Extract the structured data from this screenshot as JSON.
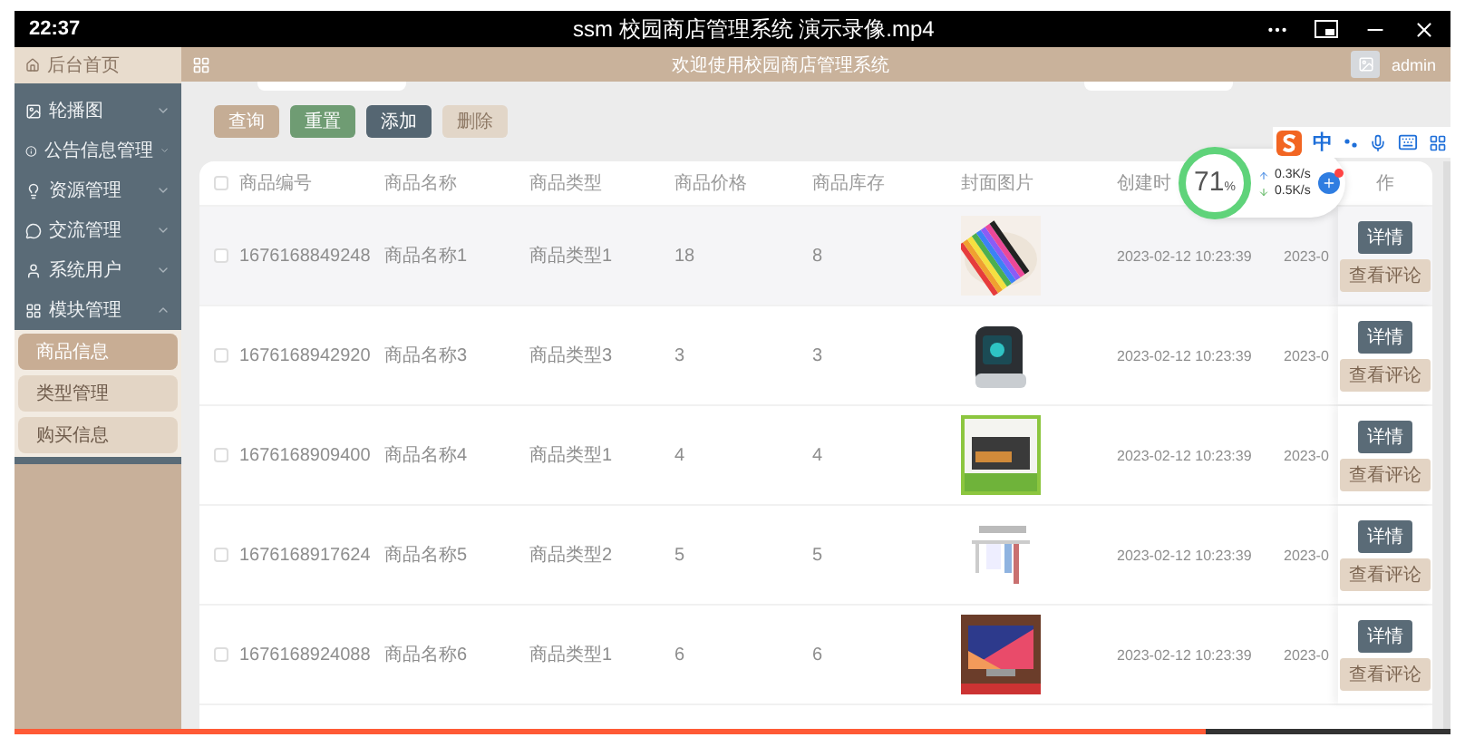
{
  "player": {
    "time": "22:37",
    "title": "ssm 校园商店管理系统 演示录像.mp4",
    "progress": {
      "level": 0.83
    }
  },
  "sidebar": {
    "home": "后台首页",
    "items": [
      {
        "label": "轮播图",
        "expanded": false
      },
      {
        "label": "公告信息管理",
        "expanded": false
      },
      {
        "label": "资源管理",
        "expanded": false
      },
      {
        "label": "交流管理",
        "expanded": false
      },
      {
        "label": "系统用户",
        "expanded": false
      },
      {
        "label": "模块管理",
        "expanded": true,
        "children": [
          {
            "label": "商品信息",
            "selected": true
          },
          {
            "label": "类型管理",
            "selected": false
          },
          {
            "label": "购买信息",
            "selected": false
          }
        ]
      }
    ]
  },
  "header": {
    "welcome": "欢迎使用校园商店管理系统",
    "user": "admin"
  },
  "toolbar": {
    "buttons": [
      {
        "label": "查询",
        "kind": "search"
      },
      {
        "label": "重置",
        "kind": "reset"
      },
      {
        "label": "添加",
        "kind": "add"
      },
      {
        "label": "删除",
        "kind": "delete"
      }
    ]
  },
  "table": {
    "all_checked": false,
    "columns": [
      "商品编号",
      "商品名称",
      "商品类型",
      "商品价格",
      "商品库存",
      "封面图片",
      "创建时"
    ],
    "actions_header": "作",
    "rows": [
      {
        "checked": false,
        "cells": [
          "1676168849248",
          "商品名称1",
          "商品类型1",
          "18",
          "8",
          {
            "kind": "picture"
          },
          "2023-02-12 10:23:39",
          "2023-0"
        ],
        "actions": [
          "详情",
          "查看评论"
        ]
      },
      {
        "checked": false,
        "cells": [
          "1676168942920",
          "商品名称3",
          "商品类型3",
          "3",
          "3",
          {
            "kind": "picture"
          },
          "2023-02-12 10:23:39",
          "2023-0"
        ],
        "actions": [
          "详情",
          "查看评论"
        ]
      },
      {
        "checked": false,
        "cells": [
          "1676168909400",
          "商品名称4",
          "商品类型1",
          "4",
          "4",
          {
            "kind": "picture"
          },
          "2023-02-12 10:23:39",
          "2023-0"
        ],
        "actions": [
          "详情",
          "查看评论"
        ]
      },
      {
        "checked": false,
        "cells": [
          "1676168917624",
          "商品名称5",
          "商品类型2",
          "5",
          "5",
          {
            "kind": "picture"
          },
          "2023-02-12 10:23:39",
          "2023-0"
        ],
        "actions": [
          "详情",
          "查看评论"
        ]
      },
      {
        "checked": false,
        "cells": [
          "1676168924088",
          "商品名称6",
          "商品类型1",
          "6",
          "6",
          {
            "kind": "picture"
          },
          "2023-02-12 10:23:39",
          "2023-0"
        ],
        "actions": [
          "详情",
          "查看评论"
        ]
      }
    ]
  },
  "monitor": {
    "percent": "71",
    "unit": "%",
    "upload": "0.3K/s",
    "download": "0.5K/s"
  },
  "ime": {
    "mode": "中"
  }
}
